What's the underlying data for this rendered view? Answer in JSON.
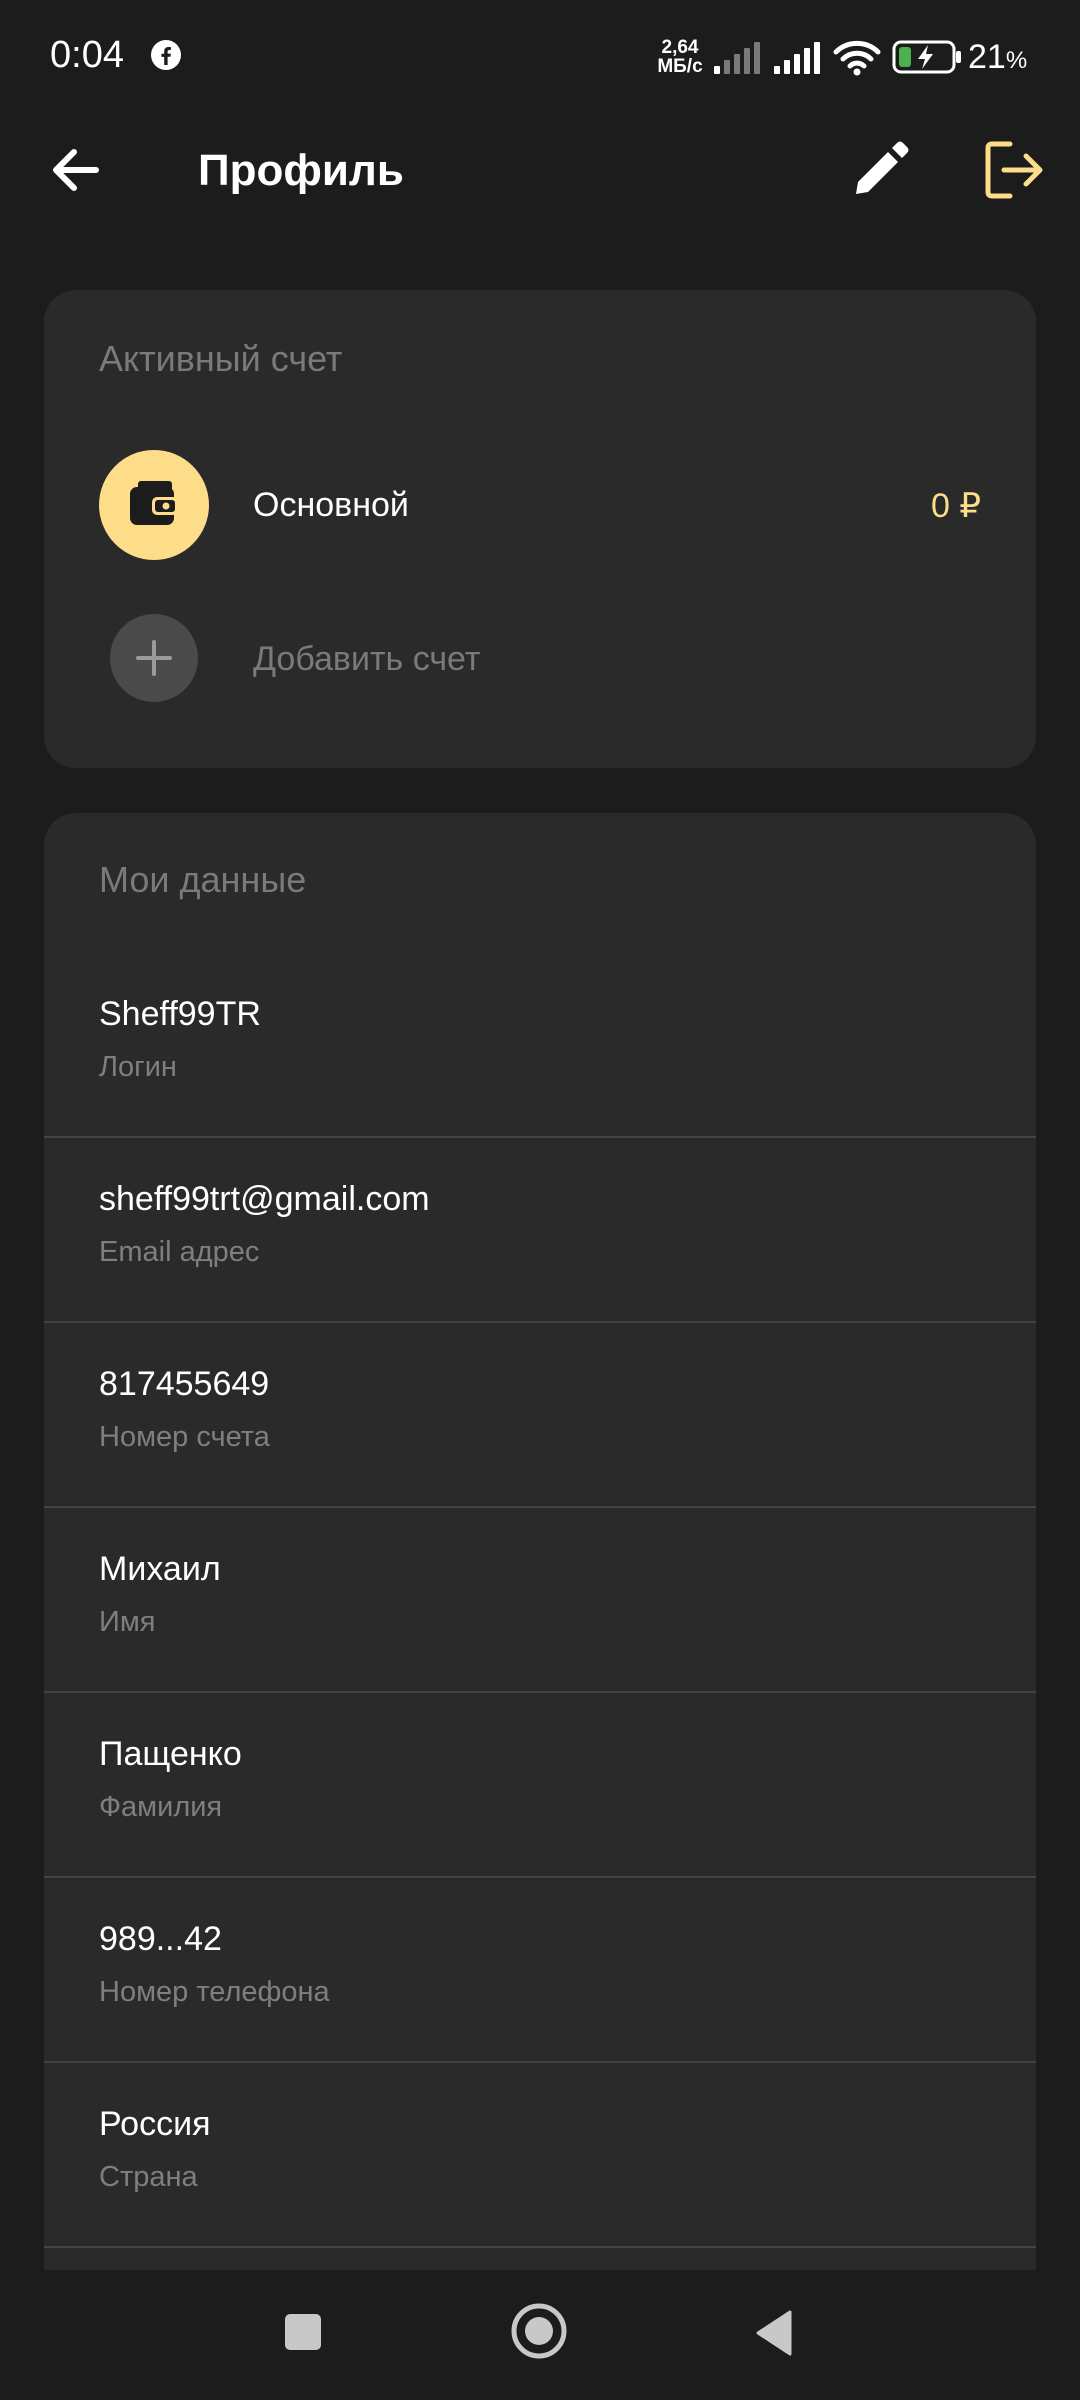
{
  "status_bar": {
    "time": "0:04",
    "net_speed_value": "2,64",
    "net_speed_unit": "МБ/с",
    "battery_level": "21",
    "battery_percent_sign": "%",
    "icons": [
      "facebook-icon",
      "signal-icon",
      "signal-icon",
      "wifi-icon",
      "battery-charging-icon"
    ]
  },
  "header": {
    "title": "Профиль",
    "back_icon": "arrow-left",
    "edit_icon": "pencil",
    "logout_icon": "logout"
  },
  "accounts": {
    "section_title": "Активный счет",
    "active": {
      "name": "Основной",
      "balance": "0 ₽",
      "icon": "wallet"
    },
    "add_label": "Добавить счет"
  },
  "my_data": {
    "section_title": "Мои данные",
    "rows": [
      {
        "value": "Sheff99TR",
        "label": "Логин"
      },
      {
        "value": "sheff99trt@gmail.com",
        "label": "Email адрес"
      },
      {
        "value": "817455649",
        "label": "Номер счета"
      },
      {
        "value": "Михаил",
        "label": "Имя"
      },
      {
        "value": "Пащенко",
        "label": "Фамилия"
      },
      {
        "value": "989...42",
        "label": "Номер телефона"
      },
      {
        "value": "Россия",
        "label": "Страна"
      }
    ]
  },
  "colors": {
    "background": "#1c1c1c",
    "card": "#2a2a2a",
    "accent": "#fddc8a",
    "muted_text": "#7a7a7a",
    "divider": "#434343"
  }
}
